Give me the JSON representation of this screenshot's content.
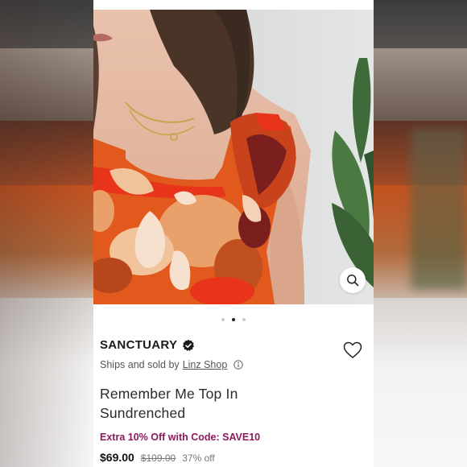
{
  "product": {
    "brand": "SANCTUARY",
    "ships_prefix": "Ships and sold by",
    "shop_name": "Linz Shop",
    "title": "Remember Me Top In Sundrenched",
    "promo": "Extra 10% Off with Code: SAVE10",
    "price": "$69.00",
    "original_price": "$109.00",
    "discount": "37% off"
  },
  "gallery": {
    "slide_count": 3,
    "active_slide": 2
  },
  "colors": {
    "promo": "#8b1a5d",
    "print_orange": "#e2591e",
    "print_peach": "#eaa06a",
    "print_red": "#e8341a"
  },
  "icons": {
    "verified": "verified-badge-icon",
    "wishlist": "heart-icon",
    "info": "info-icon",
    "zoom": "search-icon"
  }
}
